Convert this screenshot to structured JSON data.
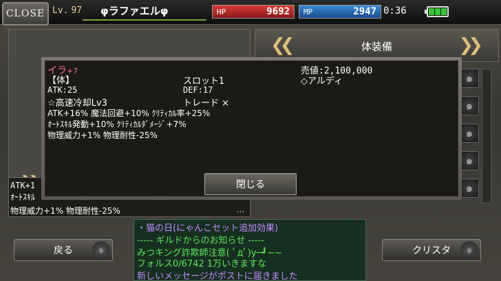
{
  "topbar": {
    "close_label": "CLOSE",
    "level_label": "Lv.",
    "level": "97",
    "character_name": "φラファエルφ",
    "hp_label": "HP",
    "hp_value": "9692",
    "mp_label": "MP",
    "mp_value": "2947",
    "clock": "0:36",
    "battery_level": 1.0
  },
  "equip_panel": {
    "title": "体装備"
  },
  "background_stats": {
    "line1": "ATK+1",
    "line2": "ｵｰﾄｽｷﾙ",
    "line3": "物理威力+1% 物理耐性-25%",
    "ellipsis": "..."
  },
  "item_popup": {
    "name": "イラ",
    "name_plus": "+7",
    "category": "【体】",
    "slot": "スロット1",
    "price": "売値:2,100,000",
    "owner": "◇アルディ",
    "atk": "ATK:25",
    "def": "DEF:17",
    "skill": "☆高速冷却Lv3",
    "trade": "トレード ×",
    "bonus_line1": "ATK+16% 魔法回避+10% ｸﾘﾃｨｶﾙ率+25%",
    "bonus_line2": "ｵｰﾄｽｷﾙ発動+10% ｸﾘﾃｨｶﾙﾀﾞﾒｰｼﾞ+7%",
    "bonus_line3": "物理威力+1% 物理耐性-25%",
    "close_button": "閉じる"
  },
  "buttons": {
    "back": "戻る",
    "crista": "クリスタ"
  },
  "chat": [
    "・猫の日(にゃんこセット追加効果)",
    "----- ギルドからのお知らせ -----",
    "みつキング詐欺師注意( ﾟдﾟ)y─┛~~",
    " フォルス0/6742  1万いきますな",
    "新しいメッセージがポストに届きました"
  ],
  "colors": {
    "item_name": "#ff6ea0",
    "chat_system": "#c08cff",
    "chat_guild": "#5ce85c",
    "hp": "#d83a3a",
    "mp": "#3a8ad8"
  }
}
